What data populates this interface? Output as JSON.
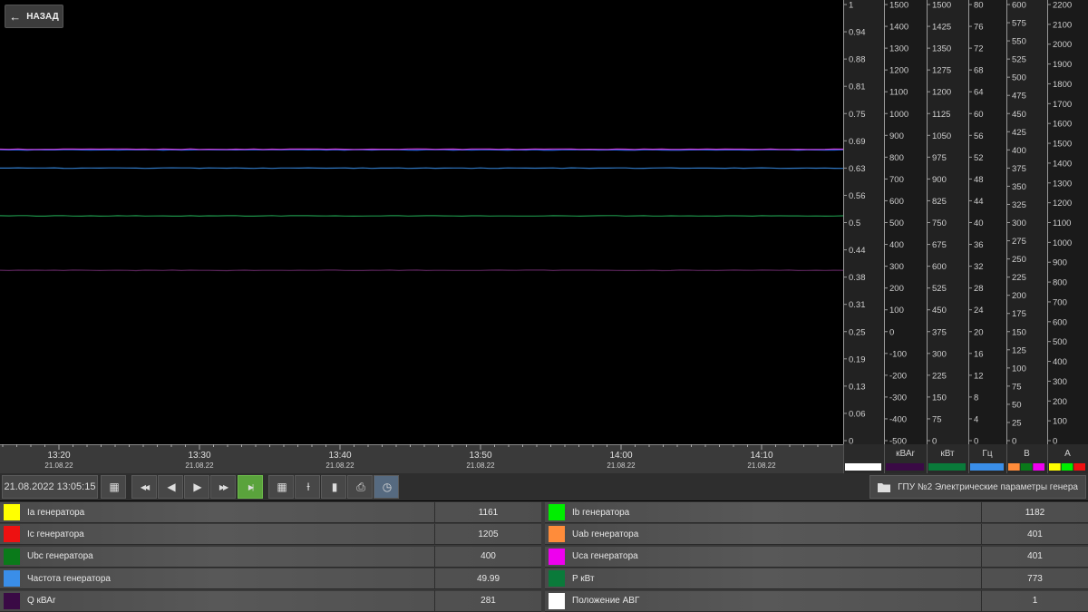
{
  "toolbar_back": {
    "label": "НАЗАД",
    "icon": "arrow-left-icon"
  },
  "chart_data": {
    "type": "line",
    "x_range": [
      "13:16",
      "14:16"
    ],
    "time_ticks": [
      {
        "time": "13:20",
        "date": "21.08.22"
      },
      {
        "time": "13:30",
        "date": "21.08.22"
      },
      {
        "time": "13:40",
        "date": "21.08.22"
      },
      {
        "time": "13:50",
        "date": "21.08.22"
      },
      {
        "time": "14:00",
        "date": "21.08.22"
      },
      {
        "time": "14:10",
        "date": "21.08.22"
      }
    ],
    "axes": [
      {
        "unit": "",
        "ticks": [
          "1",
          "0.94",
          "0.88",
          "0.81",
          "0.75",
          "0.69",
          "0.63",
          "0.56",
          "0.5",
          "0.44",
          "0.38",
          "0.31",
          "0.25",
          "0.19",
          "0.13",
          "0.06",
          "0"
        ],
        "swatches": [
          "#ffffff"
        ]
      },
      {
        "unit": "кВАr",
        "ticks": [
          "1500",
          "1400",
          "1300",
          "1200",
          "1100",
          "1000",
          "900",
          "800",
          "700",
          "600",
          "500",
          "400",
          "300",
          "200",
          "100",
          "0",
          "-100",
          "-200",
          "-300",
          "-400",
          "-500"
        ],
        "swatches": [
          "#3a0a45"
        ]
      },
      {
        "unit": "кВт",
        "ticks": [
          "1500",
          "1425",
          "1350",
          "1275",
          "1200",
          "1125",
          "1050",
          "975",
          "900",
          "825",
          "750",
          "675",
          "600",
          "525",
          "450",
          "375",
          "300",
          "225",
          "150",
          "75",
          "0"
        ],
        "swatches": [
          "#0a7a3a"
        ]
      },
      {
        "unit": "Гц",
        "ticks": [
          "80",
          "76",
          "72",
          "68",
          "64",
          "60",
          "56",
          "52",
          "48",
          "44",
          "40",
          "36",
          "32",
          "28",
          "24",
          "20",
          "16",
          "12",
          "8",
          "4",
          "0"
        ],
        "swatches": [
          "#3a8ee8"
        ]
      },
      {
        "unit": "В",
        "ticks": [
          "600",
          "575",
          "550",
          "525",
          "500",
          "475",
          "450",
          "425",
          "400",
          "375",
          "350",
          "325",
          "300",
          "275",
          "250",
          "225",
          "200",
          "175",
          "150",
          "125",
          "100",
          "75",
          "50",
          "25",
          "0"
        ],
        "swatches": [
          "#ff8c3a",
          "#0a7a1a",
          "#ee00ee"
        ]
      },
      {
        "unit": "А",
        "ticks": [
          "2200",
          "2100",
          "2000",
          "1900",
          "1800",
          "1700",
          "1600",
          "1500",
          "1400",
          "1300",
          "1200",
          "1100",
          "1000",
          "900",
          "800",
          "700",
          "600",
          "500",
          "400",
          "300",
          "200",
          "100",
          "0"
        ],
        "swatches": [
          "#ffff00",
          "#00ee00",
          "#ee1111"
        ]
      }
    ],
    "series": [
      {
        "name": "Ia генератора",
        "axis": 5,
        "value": 1161,
        "color": "#ffff33"
      },
      {
        "name": "Ib генератора",
        "axis": 5,
        "value": 1182,
        "color": "#44ee44"
      },
      {
        "name": "Ic генератора",
        "axis": 5,
        "value": 1205,
        "color": "#ee2222"
      },
      {
        "name": "Uab генератора",
        "axis": 4,
        "value": 401,
        "color": "#ff8c3a"
      },
      {
        "name": "Ubc генератора",
        "axis": 4,
        "value": 400,
        "color": "#2a6aff"
      },
      {
        "name": "Uca генератора",
        "axis": 4,
        "value": 401,
        "color": "#ee44ee"
      },
      {
        "name": "Частота генератора",
        "axis": 3,
        "value": 49.99,
        "color": "#3a8ee8"
      },
      {
        "name": "P кВт",
        "axis": 2,
        "value": 773,
        "color": "#22aa55"
      },
      {
        "name": "Q кВАr",
        "axis": 1,
        "value": 281,
        "color": "#6a2a6a"
      },
      {
        "name": "Положение АВГ",
        "axis": 0,
        "value": 1,
        "color": "#ffffff"
      }
    ]
  },
  "toolbar": {
    "datetime": "21.08.2022  13:05:15",
    "buttons": [
      {
        "name": "calendar-button",
        "icon": "calendar-icon",
        "glyph": "▦"
      },
      {
        "name": "rewind-fast-button",
        "icon": "rewind-icon",
        "glyph": "◀◀"
      },
      {
        "name": "step-back-button",
        "icon": "step-back-icon",
        "glyph": "◀"
      },
      {
        "name": "play-button",
        "icon": "play-icon",
        "glyph": "▶"
      },
      {
        "name": "forward-fast-button",
        "icon": "fast-forward-icon",
        "glyph": "▶▶"
      },
      {
        "name": "go-to-end-button",
        "icon": "skip-end-icon",
        "glyph": "▶|"
      },
      {
        "name": "grid-toggle-button",
        "icon": "grid-icon",
        "glyph": "▦"
      },
      {
        "name": "ruler-button",
        "icon": "ruler-icon",
        "glyph": "Ɨ"
      },
      {
        "name": "bookmark-button",
        "icon": "bookmark-icon",
        "glyph": "▮"
      },
      {
        "name": "print-button",
        "icon": "print-icon",
        "glyph": "⎙"
      },
      {
        "name": "clock-button",
        "icon": "clock-icon",
        "glyph": "◷"
      }
    ],
    "group_title": "ГПУ №2 Электрические параметры генера",
    "group_icon": "folder-icon"
  },
  "legend": [
    {
      "color": "#ffff00",
      "name": "Ia генератора",
      "value": "1161"
    },
    {
      "color": "#00ee00",
      "name": "Ib генератора",
      "value": "1182"
    },
    {
      "color": "#ee1111",
      "name": "Ic генератора",
      "value": "1205"
    },
    {
      "color": "#ff8c3a",
      "name": "Uab генератора",
      "value": "401"
    },
    {
      "color": "#0a7a1a",
      "name": "Ubc генератора",
      "value": "400"
    },
    {
      "color": "#ee00ee",
      "name": "Uca генератора",
      "value": "401"
    },
    {
      "color": "#3a8ee8",
      "name": "Частота генератора",
      "value": "49.99"
    },
    {
      "color": "#0a7a3a",
      "name": "P кВт",
      "value": "773"
    },
    {
      "color": "#3a0a45",
      "name": "Q кВАr",
      "value": "281"
    },
    {
      "color": "#ffffff",
      "name": "Положение АВГ",
      "value": "1"
    }
  ]
}
